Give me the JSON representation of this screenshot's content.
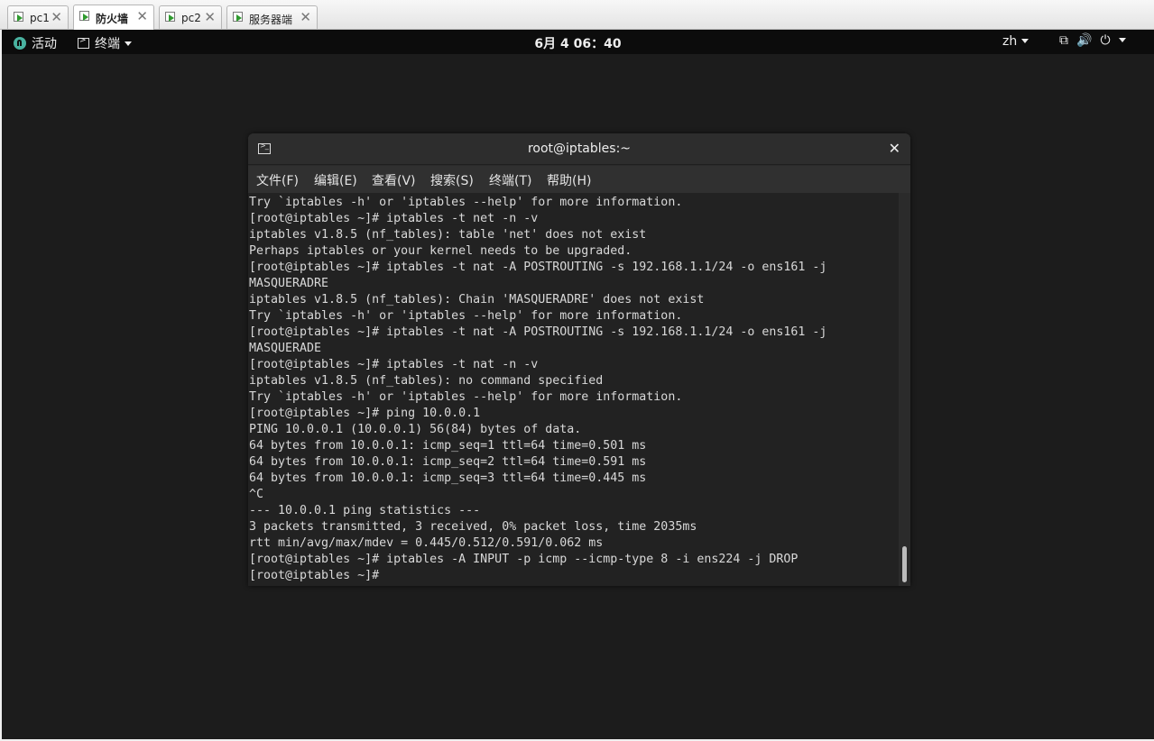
{
  "vm_tabs": [
    {
      "label": "pc1",
      "active": false
    },
    {
      "label": "防火墙",
      "active": true
    },
    {
      "label": "pc2",
      "active": false
    },
    {
      "label": "服务器端",
      "active": false
    }
  ],
  "topbar": {
    "activities": "活动",
    "app_menu": "终端",
    "clock": "6月 4 06：40",
    "language": "zh"
  },
  "terminal": {
    "title": "root@iptables:~",
    "menu": [
      "文件(F)",
      "编辑(E)",
      "查看(V)",
      "搜索(S)",
      "终端(T)",
      "帮助(H)"
    ],
    "lines": [
      "Try `iptables -h' or 'iptables --help' for more information.",
      "[root@iptables ~]# iptables -t net -n -v",
      "iptables v1.8.5 (nf_tables): table 'net' does not exist",
      "Perhaps iptables or your kernel needs to be upgraded.",
      "[root@iptables ~]# iptables -t nat -A POSTROUTING -s 192.168.1.1/24 -o ens161 -j",
      "MASQUERADRE",
      "iptables v1.8.5 (nf_tables): Chain 'MASQUERADRE' does not exist",
      "Try `iptables -h' or 'iptables --help' for more information.",
      "[root@iptables ~]# iptables -t nat -A POSTROUTING -s 192.168.1.1/24 -o ens161 -j",
      "MASQUERADE",
      "[root@iptables ~]# iptables -t nat -n -v",
      "iptables v1.8.5 (nf_tables): no command specified",
      "Try `iptables -h' or 'iptables --help' for more information.",
      "[root@iptables ~]# ping 10.0.0.1",
      "PING 10.0.0.1 (10.0.0.1) 56(84) bytes of data.",
      "64 bytes from 10.0.0.1: icmp_seq=1 ttl=64 time=0.501 ms",
      "64 bytes from 10.0.0.1: icmp_seq=2 ttl=64 time=0.591 ms",
      "64 bytes from 10.0.0.1: icmp_seq=3 ttl=64 time=0.445 ms",
      "^C",
      "--- 10.0.0.1 ping statistics ---",
      "3 packets transmitted, 3 received, 0% packet loss, time 2035ms",
      "rtt min/avg/max/mdev = 0.445/0.512/0.591/0.062 ms",
      "[root@iptables ~]# iptables -A INPUT -p icmp --icmp-type 8 -i ens224 -j DROP",
      "[root@iptables ~]# "
    ]
  }
}
